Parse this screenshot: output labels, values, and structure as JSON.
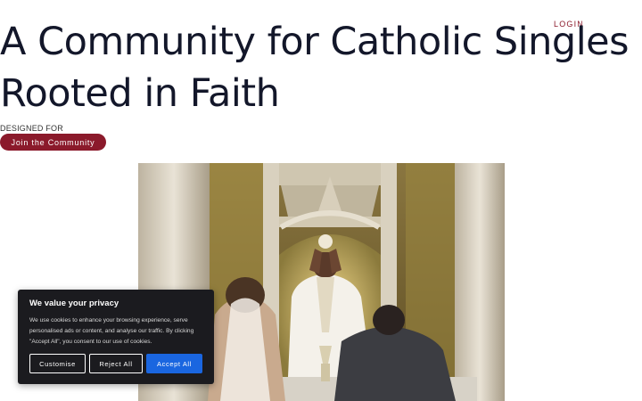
{
  "header": {
    "login_label": "LOGIN"
  },
  "hero": {
    "title_line1": "A Community for Catholic Singles",
    "title_line2": "Rooted in Faith",
    "eyebrow": "DESIGNED FOR",
    "cta_label": "Join the Community",
    "image_icon": "mass-photo"
  },
  "cookie_banner": {
    "title": "We value your privacy",
    "body": "We use cookies to enhance your browsing experience, serve personalised ads or content, and analyse our traffic. By clicking \"Accept All\", you consent to our use of cookies.",
    "customise_label": "Customise",
    "reject_label": "Reject All",
    "accept_label": "Accept All"
  },
  "colors": {
    "accent": "#8b1a2b",
    "title": "#13172a",
    "banner_bg": "#1b1b1f",
    "accept_blue": "#1a66e0"
  }
}
